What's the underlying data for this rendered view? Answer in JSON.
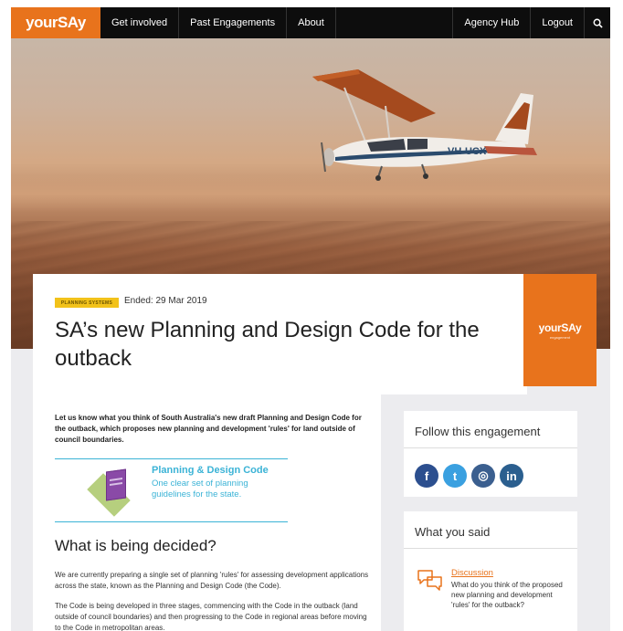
{
  "nav": {
    "logo": "yourSAy",
    "items": [
      "Get involved",
      "Past Engagements",
      "About"
    ],
    "right_items": [
      "Agency Hub",
      "Logout"
    ]
  },
  "hero": {
    "plane_registration": "VH-UCX"
  },
  "engagement": {
    "badge": "PLANNING SYSTEMS",
    "ended": "Ended: 29 Mar 2019",
    "title": "SA’s new Planning and Design Code for the outback"
  },
  "brand_panel": {
    "name": "yourSAy",
    "sub": "engagement"
  },
  "content": {
    "intro": "Let us know what you think of South Australia's new draft Planning and Design Code for the outback, which proposes new planning and development 'rules' for land outside of council boundaries.",
    "graphic": {
      "title": "Planning & Design Code",
      "description": "One clear set of planning guidelines for the state."
    },
    "heading": "What is being decided?",
    "paragraphs": [
      "We are currently preparing a single set of planning 'rules' for assessing development applications across the state, known as the Planning and Design Code (the Code).",
      "The Code is being developed in three stages, commencing with the Code in the outback (land outside of council boundaries) and then progressing to the Code in regional areas before moving to the Code in metropolitan areas."
    ]
  },
  "sidebar": {
    "follow_title": "Follow this engagement",
    "socials": [
      {
        "name": "facebook-icon",
        "glyph": "f"
      },
      {
        "name": "twitter-icon",
        "glyph": "t"
      },
      {
        "name": "instagram-icon",
        "glyph": "◎"
      },
      {
        "name": "linkedin-icon",
        "glyph": "in"
      }
    ],
    "said_title": "What you said",
    "discussion_link": "Discussion",
    "discussion_question": "What do you think of the proposed new planning and development 'rules' for the outback?"
  },
  "colors": {
    "brand_orange": "#e8731c",
    "nav_black": "#0d0d0d",
    "accent_blue": "#3bb3d6",
    "badge_yellow": "#f2c21a"
  }
}
